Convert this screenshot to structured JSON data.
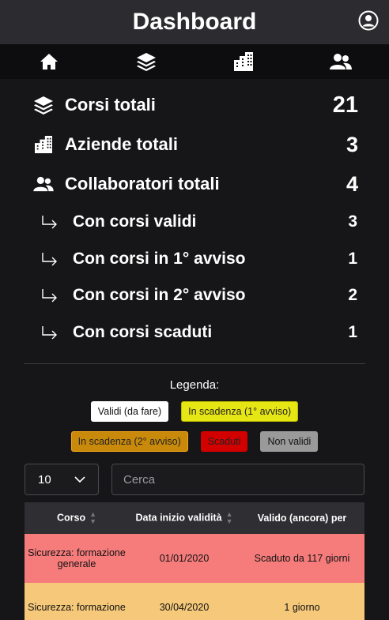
{
  "header": {
    "title": "Dashboard",
    "user_icon": "user-circle-icon"
  },
  "nav": [
    {
      "icon": "home-icon"
    },
    {
      "icon": "layers-icon"
    },
    {
      "icon": "building-icon"
    },
    {
      "icon": "users-icon"
    }
  ],
  "stats": {
    "courses": {
      "label": "Corsi totali",
      "value": "21"
    },
    "companies": {
      "label": "Aziende totali",
      "value": "3"
    },
    "collaborators": {
      "label": "Collaboratori totali",
      "value": "4"
    },
    "sub": [
      {
        "label": "Con corsi validi",
        "value": "3"
      },
      {
        "label": "Con corsi in 1° avviso",
        "value": "1"
      },
      {
        "label": "Con corsi in 2° avviso",
        "value": "2"
      },
      {
        "label": "Con corsi scaduti",
        "value": "1"
      }
    ]
  },
  "legend": {
    "title": "Legenda:",
    "items": [
      {
        "label": "Validi (da fare)",
        "color": "#ffffff"
      },
      {
        "label": "In scadenza (1° avviso)",
        "color": "#e6e615"
      },
      {
        "label": "In scadenza (2° avviso)",
        "color": "#c98a0b"
      },
      {
        "label": "Scaduti",
        "color": "#d30000"
      },
      {
        "label": "Non validi",
        "color": "#9a9a9a"
      }
    ]
  },
  "controls": {
    "page_size": "10",
    "search_placeholder": "Cerca"
  },
  "table": {
    "columns": [
      "Corso",
      "Data inizio validità",
      "Valido (ancora) per"
    ],
    "rows": [
      {
        "corso": "Sicurezza: formazione generale",
        "data": "01/01/2020",
        "valido": "Scaduto da 117 giorni",
        "status_color": "#f67c7c"
      },
      {
        "corso": "Sicurezza: formazione",
        "data": "30/04/2020",
        "valido": "1 giorno",
        "status_color": "#f6c97a"
      }
    ]
  }
}
